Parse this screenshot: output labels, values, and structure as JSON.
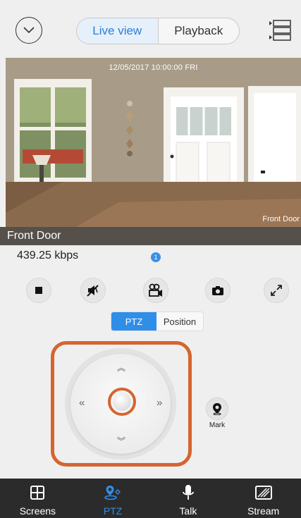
{
  "header": {
    "tabs": [
      {
        "label": "Live view",
        "active": true
      },
      {
        "label": "Playback",
        "active": false
      }
    ]
  },
  "video": {
    "timestamp": "12/05/2017 10:00:00 FRI",
    "overlay_label": "Front Door",
    "camera_name": "Front Door"
  },
  "stats": {
    "bitrate": "439.25 kbps",
    "badge_count": "1"
  },
  "toolbar": {
    "icons": [
      "stop-icon",
      "mute-icon",
      "record-icon",
      "snapshot-icon",
      "fullscreen-icon"
    ]
  },
  "control_mode": {
    "options": [
      {
        "label": "PTZ",
        "active": true
      },
      {
        "label": "Position",
        "active": false
      }
    ]
  },
  "joystick": {
    "up": "︽",
    "down": "︾",
    "left": "«",
    "right": "»"
  },
  "mark": {
    "label": "Mark"
  },
  "nav": {
    "items": [
      {
        "label": "Screens",
        "icon": "screens-icon",
        "active": false
      },
      {
        "label": "PTZ",
        "icon": "ptz-icon",
        "active": true
      },
      {
        "label": "Talk",
        "icon": "microphone-icon",
        "active": false
      },
      {
        "label": "Stream",
        "icon": "stream-icon",
        "active": false
      }
    ]
  },
  "colors": {
    "accent": "#2f8ee8",
    "highlight": "#d4652f",
    "nav_background": "#2b2b2b"
  }
}
